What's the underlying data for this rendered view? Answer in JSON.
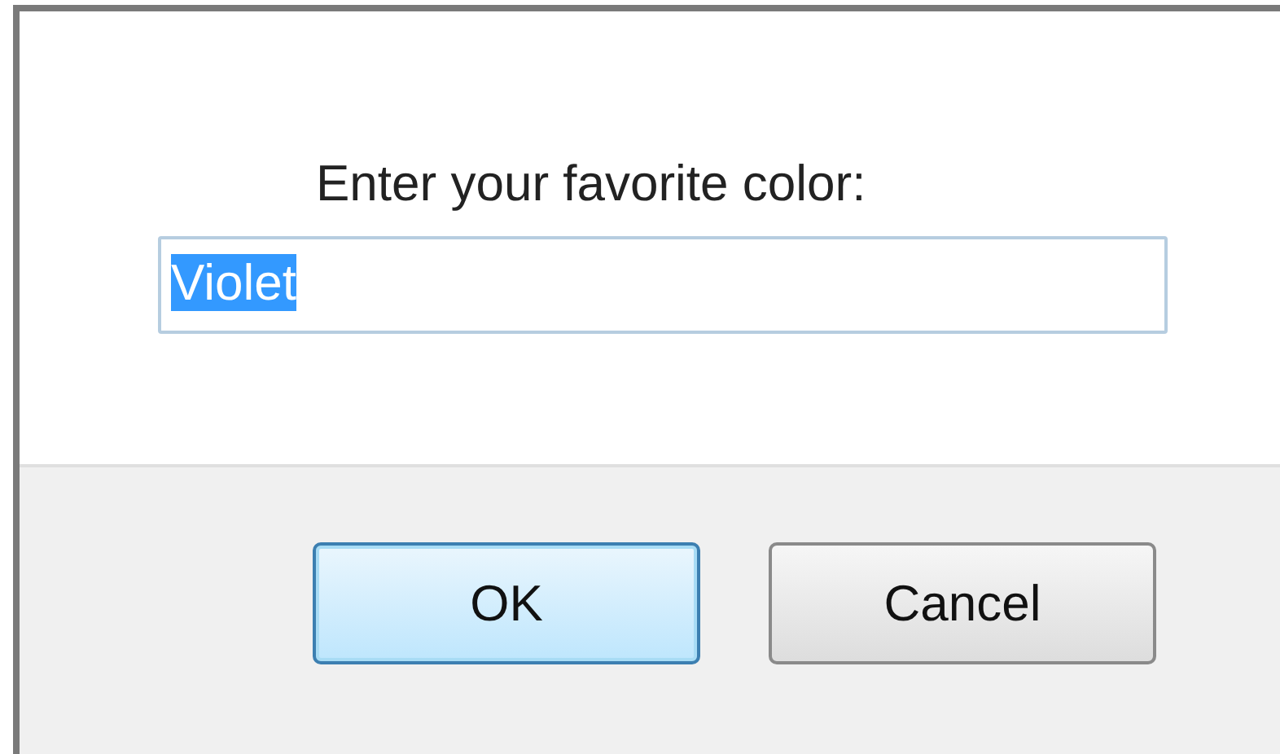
{
  "dialog": {
    "prompt": "Enter your favorite color:"
  },
  "input": {
    "value": "Violet",
    "selected": true
  },
  "buttons": [
    {
      "label": "OK",
      "default": true
    },
    {
      "label": "Cancel",
      "default": false
    }
  ]
}
